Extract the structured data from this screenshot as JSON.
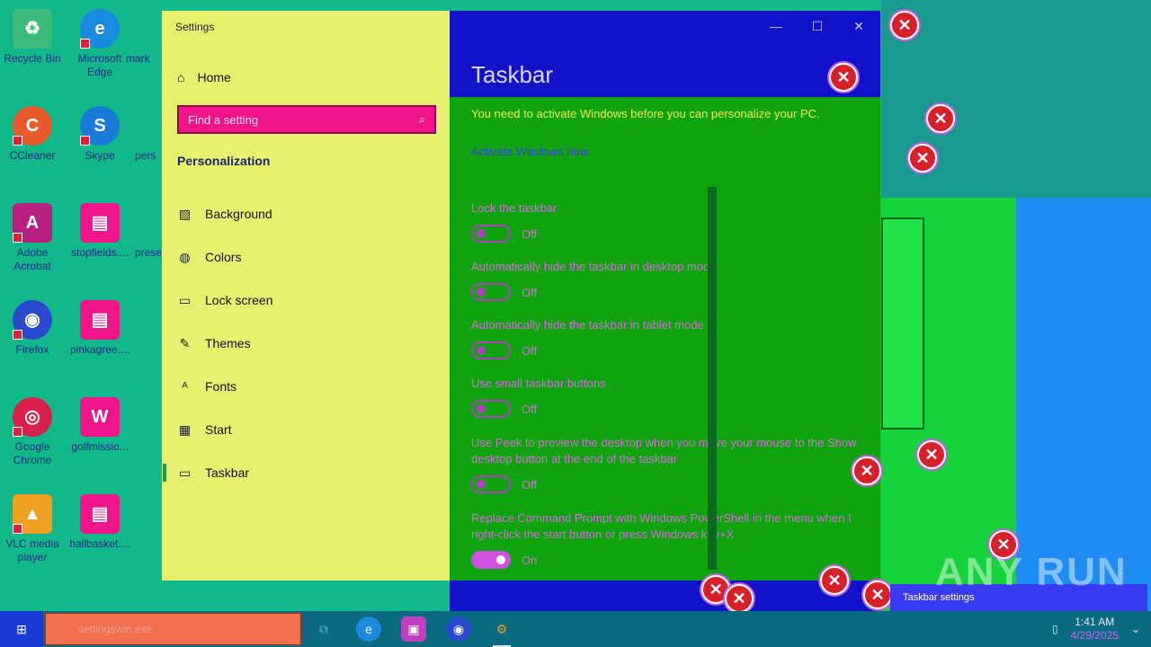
{
  "desktop": {
    "icons": [
      {
        "label": "Recycle Bin",
        "icon": "recycle-bin-icon",
        "color": "#3dbb7a"
      },
      {
        "label": "Microsoft Edge",
        "icon": "edge-icon",
        "color": "#1a8adf"
      },
      {
        "label": "CCleaner",
        "icon": "ccleaner-icon",
        "color": "#e85a2a"
      },
      {
        "label": "Skype",
        "icon": "skype-icon",
        "color": "#1a7ad8"
      },
      {
        "label": "Adobe Acrobat",
        "icon": "acrobat-icon",
        "color": "#b82080"
      },
      {
        "label": "stopfields....",
        "icon": "document-icon",
        "color": "#f0148a"
      },
      {
        "label": "Firefox",
        "icon": "firefox-icon",
        "color": "#2a4ad0"
      },
      {
        "label": "pinkagree....",
        "icon": "document-icon",
        "color": "#f0148a"
      },
      {
        "label": "Google Chrome",
        "icon": "chrome-icon",
        "color": "#d8204a"
      },
      {
        "label": "golfmissio...",
        "icon": "word-document-icon",
        "color": "#f0148a"
      },
      {
        "label": "VLC media player",
        "icon": "vlc-icon",
        "color": "#f0a020"
      },
      {
        "label": "hallbasket....",
        "icon": "document-icon",
        "color": "#f0148a"
      }
    ],
    "partial_labels": [
      "mark",
      "pers",
      "prese"
    ]
  },
  "settings": {
    "window_title": "Settings",
    "home_label": "Home",
    "search_placeholder": "Find a setting",
    "section_heading": "Personalization",
    "nav": [
      {
        "label": "Background",
        "icon": "picture-icon"
      },
      {
        "label": "Colors",
        "icon": "palette-icon"
      },
      {
        "label": "Lock screen",
        "icon": "lock-screen-icon"
      },
      {
        "label": "Themes",
        "icon": "themes-icon"
      },
      {
        "label": "Fonts",
        "icon": "fonts-icon"
      },
      {
        "label": "Start",
        "icon": "start-icon"
      },
      {
        "label": "Taskbar",
        "icon": "taskbar-icon"
      }
    ],
    "active_nav": "Taskbar",
    "controls": {
      "minimize": "—",
      "maximize": "☐",
      "close": "✕"
    },
    "page_title": "Taskbar",
    "warning": "You need to activate Windows before you can personalize your PC.",
    "activate_link": "Activate Windows now.",
    "options": [
      {
        "label": "Lock the taskbar",
        "state": "Off"
      },
      {
        "label": "Automatically hide the taskbar in desktop mode",
        "state": "Off"
      },
      {
        "label": "Automatically hide the taskbar in tablet mode",
        "state": "Off"
      },
      {
        "label": "Use small taskbar buttons",
        "state": "Off"
      },
      {
        "label": "Use Peek to preview the desktop when you move your mouse to the Show desktop button at the end of the taskbar",
        "state": "Off"
      },
      {
        "label": "Replace Command Prompt with Windows PowerShell in the menu when I right-click the start button or press Windows key+X",
        "state": "On"
      }
    ]
  },
  "overlay": {
    "watermark": "ANY RUN",
    "notification": "Taskbar settings"
  },
  "taskbar": {
    "search_value": "settingswin.exe",
    "apps": [
      "task-view-icon",
      "edge-icon",
      "store-icon",
      "firefox-icon",
      "settings-gear-icon"
    ],
    "time": "1:41 AM",
    "date": "4/29/2025"
  }
}
